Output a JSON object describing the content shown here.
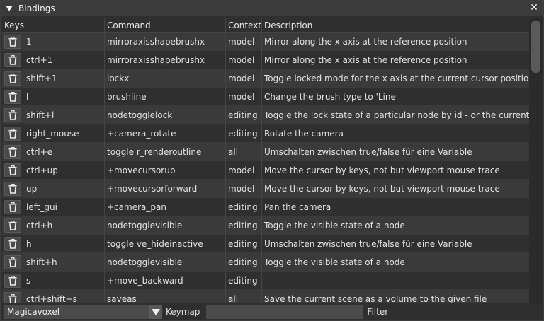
{
  "window": {
    "title": "Bindings",
    "close_glyph": "✕"
  },
  "table": {
    "headers": {
      "keys": "Keys",
      "command": "Command",
      "context": "Context",
      "description": "Description"
    },
    "rows": [
      {
        "keys": "1",
        "command": "mirroraxisshapebrushx",
        "context": "model",
        "description": "Mirror along the x axis at the reference position"
      },
      {
        "keys": "ctrl+1",
        "command": "mirroraxisshapebrushx",
        "context": "model",
        "description": "Mirror along the x axis at the reference position"
      },
      {
        "keys": "shift+1",
        "command": "lockx",
        "context": "model",
        "description": "Toggle locked mode for the x axis at the current cursor position"
      },
      {
        "keys": "l",
        "command": "brushline",
        "context": "model",
        "description": "Change the brush type to 'Line'"
      },
      {
        "keys": "shift+l",
        "command": "nodetogglelock",
        "context": "editing",
        "description": "Toggle the lock state of a particular node by id - or the current active o"
      },
      {
        "keys": "right_mouse",
        "command": "+camera_rotate",
        "context": "editing",
        "description": "Rotate the camera"
      },
      {
        "keys": "ctrl+e",
        "command": "toggle r_renderoutline",
        "context": "all",
        "description": "Umschalten zwischen true/false für eine Variable"
      },
      {
        "keys": "ctrl+up",
        "command": "+movecursorup",
        "context": "model",
        "description": "Move the cursor by keys, not but viewport mouse trace"
      },
      {
        "keys": "up",
        "command": "+movecursorforward",
        "context": "model",
        "description": "Move the cursor by keys, not but viewport mouse trace"
      },
      {
        "keys": "left_gui",
        "command": "+camera_pan",
        "context": "editing",
        "description": "Pan the camera"
      },
      {
        "keys": "ctrl+h",
        "command": "nodetogglevisible",
        "context": "editing",
        "description": "Toggle the visible state of a node"
      },
      {
        "keys": "h",
        "command": "toggle ve_hideinactive",
        "context": "editing",
        "description": "Umschalten zwischen true/false für eine Variable"
      },
      {
        "keys": "shift+h",
        "command": "nodetogglevisible",
        "context": "editing",
        "description": "Toggle the visible state of a node"
      },
      {
        "keys": "s",
        "command": "+move_backward",
        "context": "editing",
        "description": ""
      },
      {
        "keys": "ctrl+shift+s",
        "command": "saveas",
        "context": "all",
        "description": "Save the current scene as a volume to the given file"
      }
    ]
  },
  "bottom": {
    "keymap_value": "Magicavoxel",
    "keymap_label": "Keymap",
    "filter_value": "",
    "filter_label": "Filter"
  },
  "icons": {
    "delete": "trash-icon",
    "collapse": "triangle-down-icon",
    "close": "close-icon",
    "dropdown": "triangle-down-icon"
  }
}
